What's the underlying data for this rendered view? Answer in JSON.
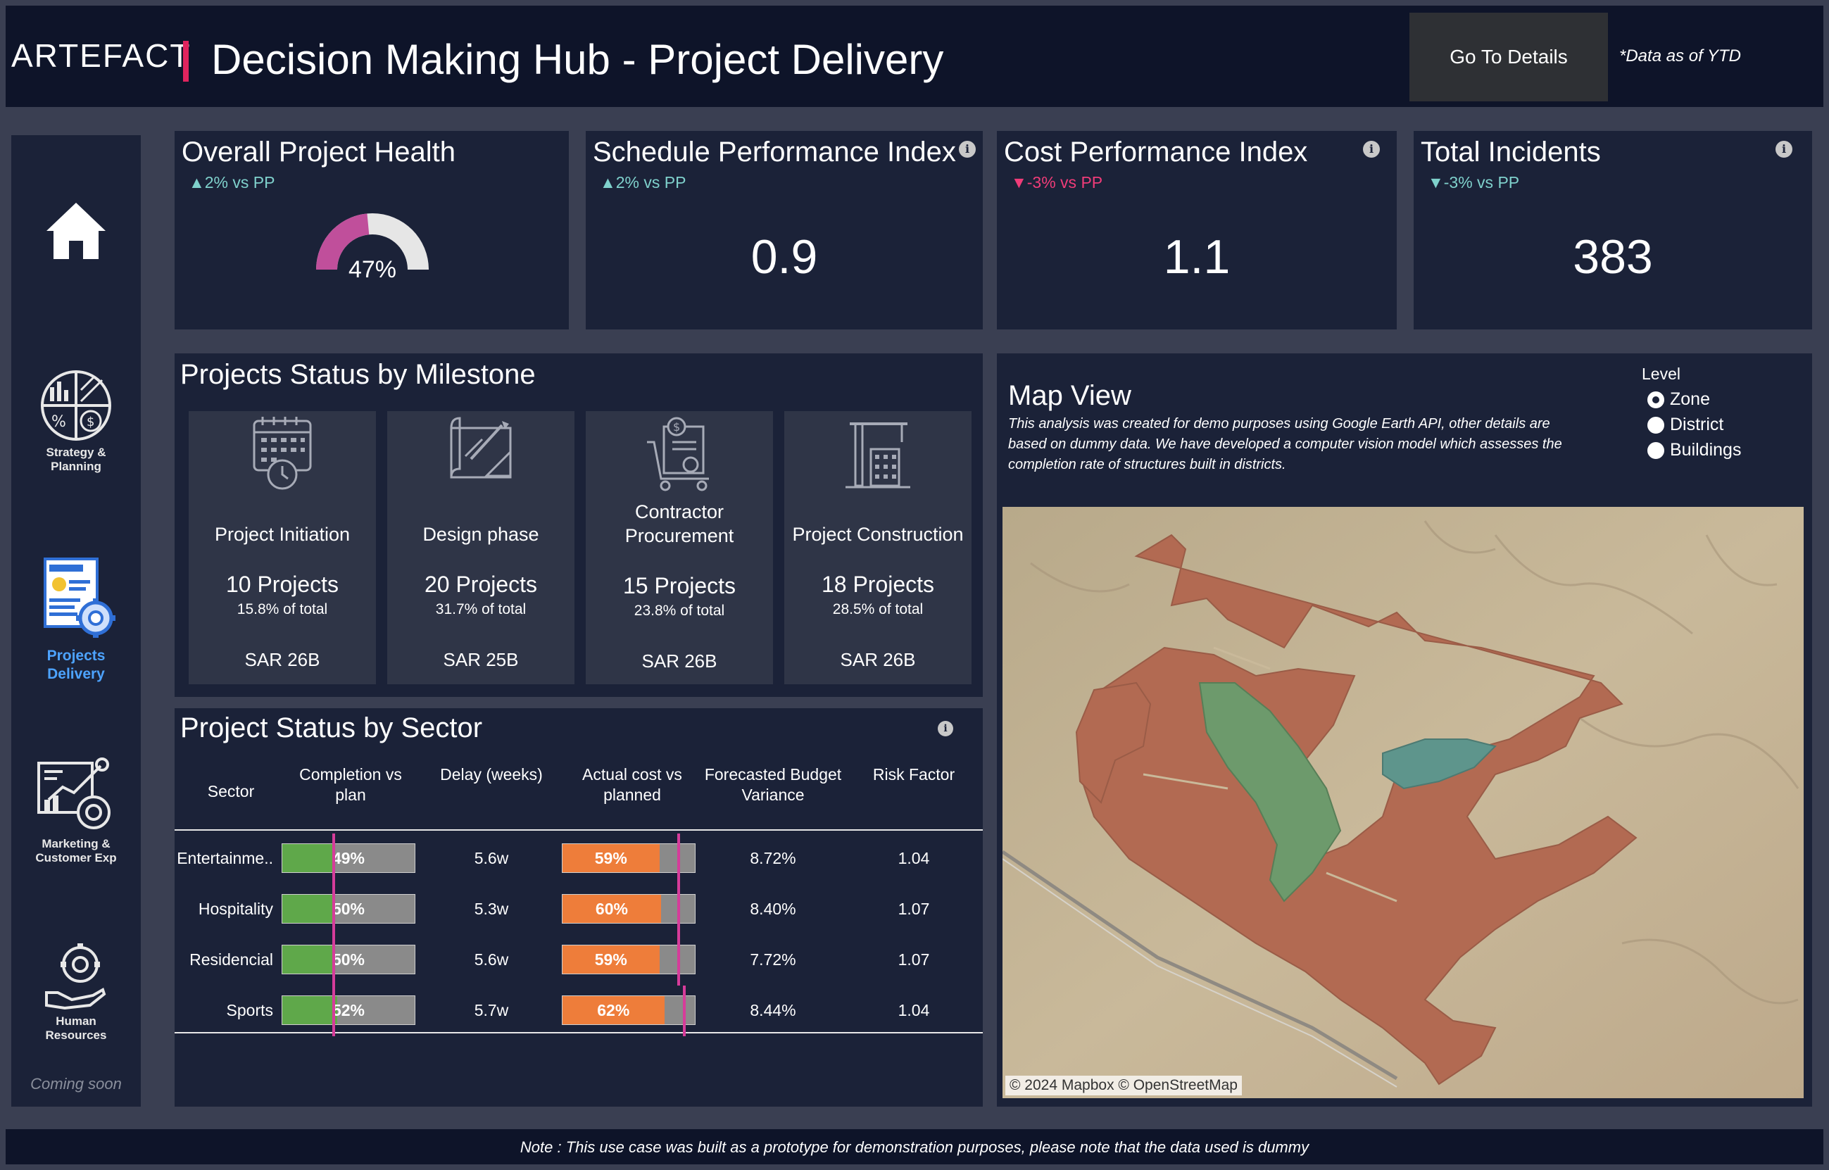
{
  "header": {
    "logo_text": "ARTEFACT",
    "title": "Decision Making Hub - Project Delivery",
    "go_to_details_label": "Go To Details",
    "data_note": "*Data as of YTD"
  },
  "sidebar": {
    "items": [
      {
        "label": "",
        "icon": "home-icon"
      },
      {
        "label_line1": "Strategy &",
        "label_line2": "Planning",
        "icon": "strategy-planning-icon"
      },
      {
        "label_line1": "Projects",
        "label_line2": "Delivery",
        "icon": "projects-delivery-icon",
        "active": true
      },
      {
        "label_line1": "Marketing &",
        "label_line2": "Customer Exp",
        "icon": "marketing-icon"
      },
      {
        "label_line1": "Human",
        "label_line2": "Resources",
        "icon": "human-resources-icon"
      }
    ],
    "coming_soon": "Coming soon"
  },
  "kpis": {
    "health": {
      "title": "Overall Project Health",
      "delta": "2% vs PP",
      "delta_dir": "up",
      "value_text": "47%",
      "value": 47
    },
    "spi": {
      "title": "Schedule Performance Index",
      "delta": "2% vs PP",
      "delta_dir": "up",
      "value": "0.9"
    },
    "cpi": {
      "title": "Cost Performance Index",
      "delta": "-3% vs PP",
      "delta_dir": "down",
      "value": "1.1"
    },
    "incidents": {
      "title": "Total Incidents",
      "delta": "-3% vs PP",
      "delta_dir": "down",
      "value": "383"
    }
  },
  "milestones": {
    "title": "Projects Status by Milestone",
    "items": [
      {
        "name": "Project Initiation",
        "count": "10 Projects",
        "pct": "15.8% of total",
        "sar": "SAR 26B",
        "icon": "calendar-clock-icon"
      },
      {
        "name": "Design phase",
        "count": "20 Projects",
        "pct": "31.7% of total",
        "sar": "SAR 25B",
        "icon": "blueprint-icon"
      },
      {
        "name_line1": "Contractor",
        "name_line2": "Procurement",
        "count": "15 Projects",
        "pct": "23.8% of total",
        "sar": "SAR 26B",
        "icon": "procurement-cart-icon"
      },
      {
        "name": "Project Construction",
        "count": "18 Projects",
        "pct": "28.5% of total",
        "sar": "SAR 26B",
        "icon": "construction-crane-icon"
      }
    ]
  },
  "sector": {
    "title": "Project Status by Sector",
    "headers": {
      "sector": "Sector",
      "completion_l1": "Completion vs",
      "completion_l2": "plan",
      "delay": "Delay (weeks)",
      "cost_l1": "Actual cost vs",
      "cost_l2": "planned",
      "budget_l1": "Forecasted Budget",
      "budget_l2": "Variance",
      "risk": "Risk Factor"
    },
    "rows": [
      {
        "sector": "Entertainme..",
        "completion": "49%",
        "completion_value": 49,
        "delay": "5.6w",
        "cost": "59%",
        "cost_value": 59,
        "budget": "8.72%",
        "risk": "1.04"
      },
      {
        "sector": "Hospitality",
        "completion": "50%",
        "completion_value": 50,
        "delay": "5.3w",
        "cost": "60%",
        "cost_value": 60,
        "budget": "8.40%",
        "risk": "1.07"
      },
      {
        "sector": "Residencial",
        "completion": "50%",
        "completion_value": 50,
        "delay": "5.6w",
        "cost": "59%",
        "cost_value": 59,
        "budget": "7.72%",
        "risk": "1.07"
      },
      {
        "sector": "Sports",
        "completion": "52%",
        "completion_value": 52,
        "delay": "5.7w",
        "cost": "62%",
        "cost_value": 62,
        "budget": "8.44%",
        "risk": "1.04"
      }
    ]
  },
  "map": {
    "title": "Map View",
    "desc_l1": "This analysis was created for demo purposes using Google Earth API, other details are",
    "desc_l2": "based on dummy data. We have developed a computer vision model which assesses the",
    "desc_l3": "completion rate of structures built in districts.",
    "level_label": "Level",
    "level_options": [
      "Zone",
      "District",
      "Buildings"
    ],
    "selected_level": "Zone",
    "attribution": "© 2024 Mapbox  © OpenStreetMap"
  },
  "footer": {
    "note": "Note : This use case was built as a prototype for demonstration purposes, please note that the data used is dummy"
  },
  "colors": {
    "background": "#3a3f52",
    "header": "#0e1429",
    "card": "#1b2238",
    "accent_pink": "#e0245e",
    "up_teal": "#7fd1cc",
    "down_pink": "#f03c79",
    "completion_green": "#5fa84a",
    "cost_orange": "#ee7d3a",
    "plan_marker": "#d63c9a",
    "gauge_fill": "#c04f9b",
    "zone_brown": "#b26a52",
    "zone_green": "#6d9a6c",
    "zone_teal": "#5e958c"
  }
}
